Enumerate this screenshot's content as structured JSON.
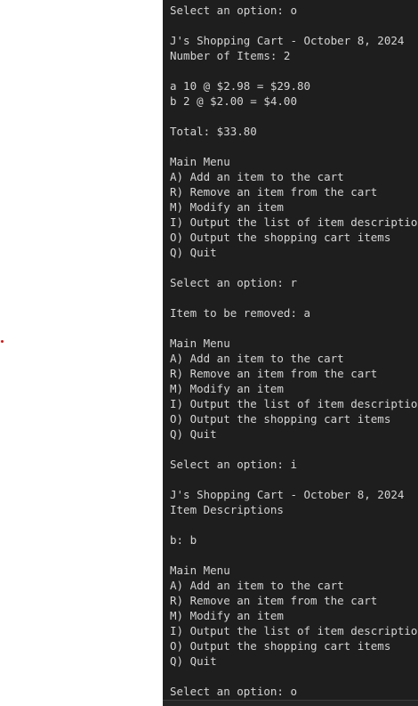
{
  "terminal": {
    "lines": [
      "Select an option: o",
      "",
      "J's Shopping Cart - October 8, 2024",
      "Number of Items: 2",
      "",
      "a 10 @ $2.98 = $29.80",
      "b 2 @ $2.00 = $4.00",
      "",
      "Total: $33.80",
      "",
      "Main Menu",
      "A) Add an item to the cart",
      "R) Remove an item from the cart",
      "M) Modify an item",
      "I) Output the list of item descriptions",
      "O) Output the shopping cart items",
      "Q) Quit",
      "",
      "Select an option: r",
      "",
      "Item to be removed: a",
      "",
      "Main Menu",
      "A) Add an item to the cart",
      "R) Remove an item from the cart",
      "M) Modify an item",
      "I) Output the list of item descriptions",
      "O) Output the shopping cart items",
      "Q) Quit",
      "",
      "Select an option: i",
      "",
      "J's Shopping Cart - October 8, 2024",
      "Item Descriptions",
      "",
      "b: b",
      "",
      "Main Menu",
      "A) Add an item to the cart",
      "R) Remove an item from the cart",
      "M) Modify an item",
      "I) Output the list of item descriptions",
      "O) Output the shopping cart items",
      "Q) Quit",
      "",
      "Select an option: o"
    ]
  },
  "colors": {
    "terminal_bg": "#1e1e1e",
    "terminal_text": "#d4d4d4",
    "marker": "#d11a1a"
  }
}
